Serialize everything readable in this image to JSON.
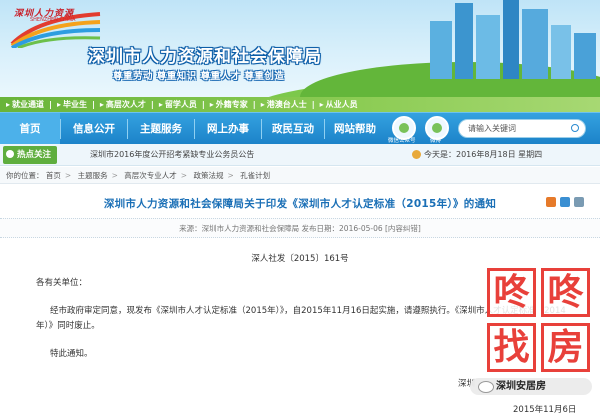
{
  "banner": {
    "logo_text": "深圳人力资源",
    "logo_subtext": "SHENZHEN CHINA",
    "title": "深圳市人力资源和社会保障局",
    "slogan": "尊重劳动 尊重知识 尊重人才 尊重创造"
  },
  "quick_links": [
    "就业通道",
    "毕业生",
    "高层次人才",
    "留学人员",
    "外籍专家",
    "港澳台人士",
    "从业人员"
  ],
  "nav": {
    "items": [
      "首页",
      "信息公开",
      "主题服务",
      "网上办事",
      "政民互动",
      "网站帮助"
    ],
    "round_icons": [
      "微信公众号",
      "微博"
    ],
    "search_placeholder": "请输入关键词"
  },
  "hot": {
    "label": "热点关注",
    "text": "深圳市2016年度公开招考紧缺专业公务员公告",
    "date": "今天是：2016年8月18日 星期四"
  },
  "breadcrumb": {
    "prefix": "你的位置：",
    "items": [
      "首页",
      "主题服务",
      "高层次专业人才",
      "政策法规",
      "孔雀计划"
    ]
  },
  "article": {
    "title": "深圳市人力资源和社会保障局关于印发《深圳市人才认定标准（2015年）》的通知",
    "meta": "来源：深圳市人力资源和社会保障局   发布日期：2016-05-06   [内容纠错]",
    "doc_no": "深人社发〔2015〕161号",
    "salutation": "各有关单位：",
    "body_line1": "经市政府审定同意，现发布《深圳市人才认定标准（2015年）》，自2015年11月16日起实施，请遵照执行。《深圳市人才认定标准（2014",
    "body_line2": "年）》同时废止。",
    "closing": "特此通知。",
    "issuer_partial": "深圳",
    "date": "2015年11月6日"
  },
  "watermark": {
    "chars": [
      "咚",
      "咚",
      "找",
      "房"
    ],
    "badge": "深圳安居房"
  },
  "colors": {
    "nav_blue": "#1c83c9",
    "green": "#5fae3e",
    "title_blue": "#1a6fb6",
    "watermark_red": "#e8403a"
  }
}
